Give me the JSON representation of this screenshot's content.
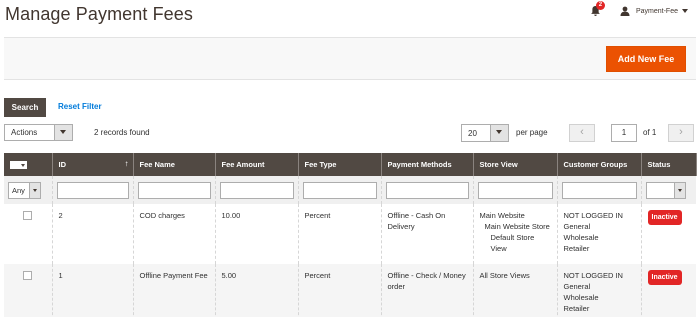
{
  "page": {
    "title": "Manage Payment Fees"
  },
  "header": {
    "notification_count": "2",
    "user_name": "Payment-Fee"
  },
  "action_bar": {
    "add_button_label": "Add New Fee"
  },
  "filters_bar": {
    "search_label": "Search",
    "reset_label": "Reset Filter"
  },
  "toolbar": {
    "actions_label": "Actions",
    "records_found": "2 records found",
    "per_page_value": "20",
    "per_page_label": "per page",
    "current_page": "1",
    "total_pages_label": "of 1",
    "prev_icon": "chevron-left-icon",
    "next_icon": "chevron-right-icon"
  },
  "grid": {
    "columns": {
      "id": "ID",
      "fee_name": "Fee Name",
      "fee_amount": "Fee Amount",
      "fee_type": "Fee Type",
      "payment_methods": "Payment Methods",
      "store_view": "Store View",
      "customer_groups": "Customer Groups",
      "status": "Status"
    },
    "filter_any": "Any",
    "rows": [
      {
        "id": "2",
        "fee_name": "COD charges",
        "fee_amount": "10.00",
        "fee_type": "Percent",
        "payment_methods": "Offline - Cash On Delivery",
        "store_view": [
          "Main Website",
          "Main Website Store",
          "Default Store View"
        ],
        "customer_groups": [
          "NOT LOGGED IN",
          "General",
          "Wholesale",
          "Retailer"
        ],
        "status": "Inactive"
      },
      {
        "id": "1",
        "fee_name": "Offline Payment Fee",
        "fee_amount": "5.00",
        "fee_type": "Percent",
        "payment_methods": "Offline - Check / Money order",
        "store_view": [
          "All Store Views"
        ],
        "customer_groups": [
          "NOT LOGGED IN",
          "General",
          "Wholesale",
          "Retailer"
        ],
        "status": "Inactive"
      }
    ]
  },
  "colors": {
    "accent": "#eb5202",
    "header_dark": "#514943",
    "link": "#007bdb",
    "status_inactive": "#e22626"
  }
}
